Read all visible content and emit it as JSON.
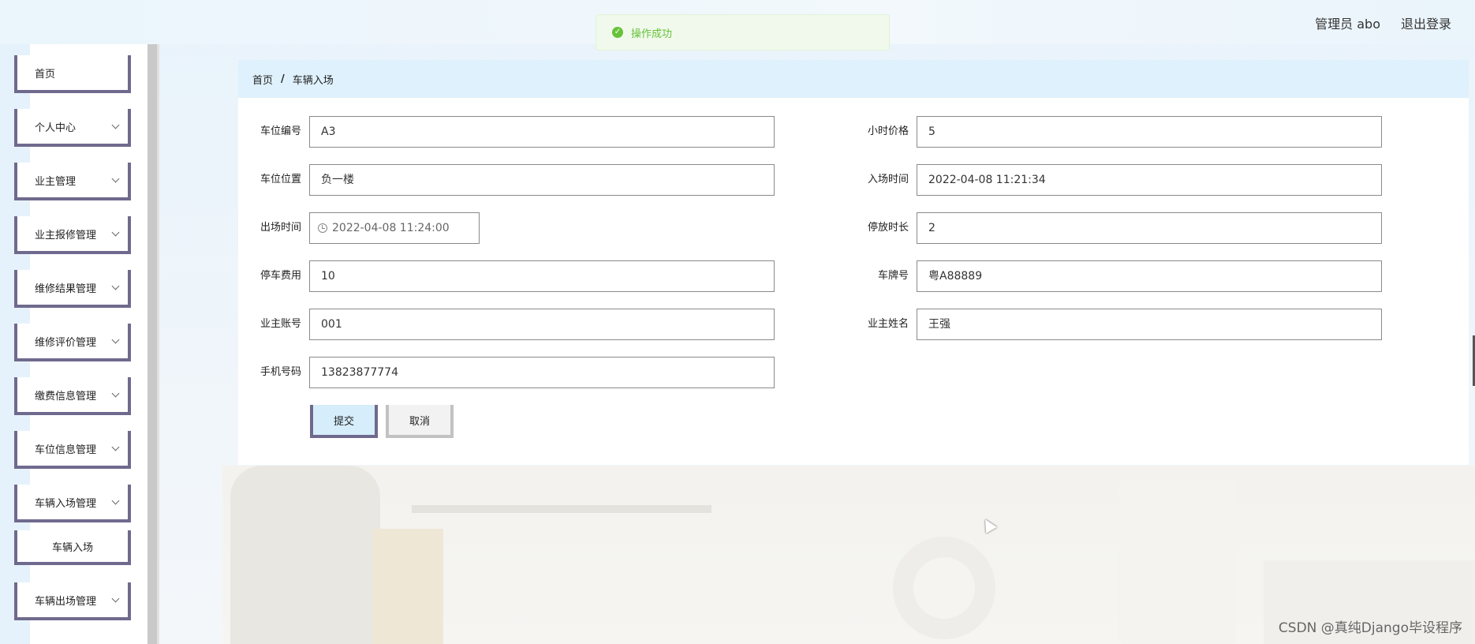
{
  "header": {
    "user_label": "管理员 abo",
    "logout_label": "退出登录"
  },
  "toast": {
    "message": "操作成功",
    "icon": "check-circle-icon",
    "color": "#67c23a"
  },
  "sidebar": {
    "items": [
      {
        "label": "首页"
      },
      {
        "label": "个人中心"
      },
      {
        "label": "业主管理"
      },
      {
        "label": "业主报修管理"
      },
      {
        "label": "维修结果管理"
      },
      {
        "label": "维修评价管理"
      },
      {
        "label": "缴费信息管理"
      },
      {
        "label": "车位信息管理"
      },
      {
        "label": "车辆入场管理"
      },
      {
        "label": "车辆入场"
      },
      {
        "label": "车辆出场管理"
      }
    ]
  },
  "breadcrumb": {
    "home": "首页",
    "separator": "/",
    "current": "车辆入场"
  },
  "form": {
    "fields": [
      {
        "label": "车位编号",
        "value": "A3"
      },
      {
        "label": "小时价格",
        "value": "5"
      },
      {
        "label": "车位位置",
        "value": "负一楼"
      },
      {
        "label": "入场时间",
        "value": "2022-04-08 11:21:34"
      },
      {
        "label": "出场时间",
        "value": "2022-04-08 11:24:00"
      },
      {
        "label": "停放时长",
        "value": "2"
      },
      {
        "label": "停车费用",
        "value": "10"
      },
      {
        "label": "车牌号",
        "value": "粤A88889"
      },
      {
        "label": "业主账号",
        "value": "001"
      },
      {
        "label": "业主姓名",
        "value": "王强"
      },
      {
        "label": "手机号码",
        "value": "13823877774"
      }
    ],
    "submit_label": "提交",
    "cancel_label": "取消"
  },
  "watermark": "CSDN @真纯Django毕设程序",
  "colors": {
    "accent_border": "#6f6a8d",
    "breadcrumb_bg": "#dff1fc",
    "submit_bg": "#d6edfb"
  }
}
